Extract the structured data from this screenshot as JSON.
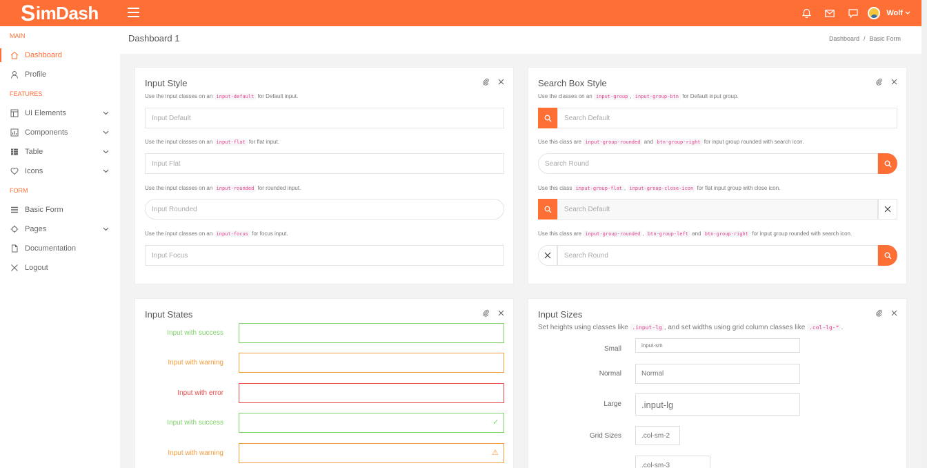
{
  "brand": {
    "logo_s": "S",
    "logo_rest": "imDash"
  },
  "topbar": {
    "user_name": "Wolf"
  },
  "sidebar": {
    "sections": [
      "MAIN",
      "FEATURES",
      "FORM"
    ],
    "items": [
      {
        "label": "Dashboard",
        "icon": "home-icon"
      },
      {
        "label": "Profile",
        "icon": "user-icon"
      },
      {
        "label": "UI Elements",
        "icon": "layout-icon"
      },
      {
        "label": "Components",
        "icon": "chart-icon"
      },
      {
        "label": "Table",
        "icon": "table-icon"
      },
      {
        "label": "Icons",
        "icon": "heart-icon"
      },
      {
        "label": "Basic Form",
        "icon": "list-icon"
      },
      {
        "label": "Pages",
        "icon": "target-icon"
      },
      {
        "label": "Documentation",
        "icon": "file-icon"
      },
      {
        "label": "Logout",
        "icon": "close-icon"
      }
    ]
  },
  "header": {
    "title": "Dashboard 1",
    "crumb1": "Dashboard",
    "sep": "/",
    "crumb2": "Basic Form"
  },
  "input_style": {
    "title": "Input Style",
    "hint_pre": "Use the input classes on an",
    "h1_code": "input-default",
    "h1_post": "for Default input.",
    "h2_code": "input-flat",
    "h2_post": "for flat input.",
    "h3_code": "input-rounded",
    "h3_post": "for rounded input.",
    "h4_code": "input-focus",
    "h4_post": "for focus input.",
    "ph1": "Input Default",
    "ph2": "Input Flat",
    "ph3": "Input Rounded",
    "ph4": "Input Focus"
  },
  "search_style": {
    "title": "Search Box Style",
    "h1_pre": "Use the classes on an",
    "h1_c1": "input-group",
    "h1_sep": ",",
    "h1_c2": "input-group-btn",
    "h1_post": "for Default input group.",
    "h2_pre": "Use this class are",
    "h2_c1": "input-group-rounded",
    "h2_and": "and",
    "h2_c2": "btn-group-right",
    "h2_post": "for input group rounded with search icon.",
    "h3_pre": "Use this class",
    "h3_c1": "input-group-flat",
    "h3_sep": ",",
    "h3_c2": "input-group-close-icon",
    "h3_post": "for flat input group with close icon.",
    "h4_pre": "Use this class are",
    "h4_c1": "input-group-rounded",
    "h4_sep": ",",
    "h4_c2": "btn-group-left",
    "h4_and": "and",
    "h4_c3": "btn-group-right",
    "h4_post": "for input group rounded with search icon.",
    "ph1": "Search Default",
    "ph2": "Search Round",
    "ph3": "Search Default",
    "ph4": "Search Round"
  },
  "input_states": {
    "title": "Input States",
    "l1": "Input with success",
    "l2": "Input with warning",
    "l3": "Input with error",
    "l4": "Input with success",
    "l5": "Input with warning",
    "check": "✓",
    "alert": "⚠"
  },
  "input_sizes": {
    "title": "Input Sizes",
    "desc_pre": "Set heights using classes like",
    "desc_c1": ".input-lg",
    "desc_mid": ", and set widths using grid column classes like",
    "desc_c2": ".col-lg-*",
    "desc_post": ".",
    "l_small": "Small",
    "l_normal": "Normal",
    "l_large": "Large",
    "l_grid": "Grid Sizes",
    "ph_small": "input-sm",
    "ph_normal": "Normal",
    "ph_large": ".input-lg",
    "ph_col2": ".col-sm-2",
    "ph_col3": ".col-sm-3"
  },
  "colors": {
    "accent": "#fe6f36",
    "success": "#7ed36b",
    "warning": "#f39c3b",
    "error": "#ec4a4a"
  }
}
